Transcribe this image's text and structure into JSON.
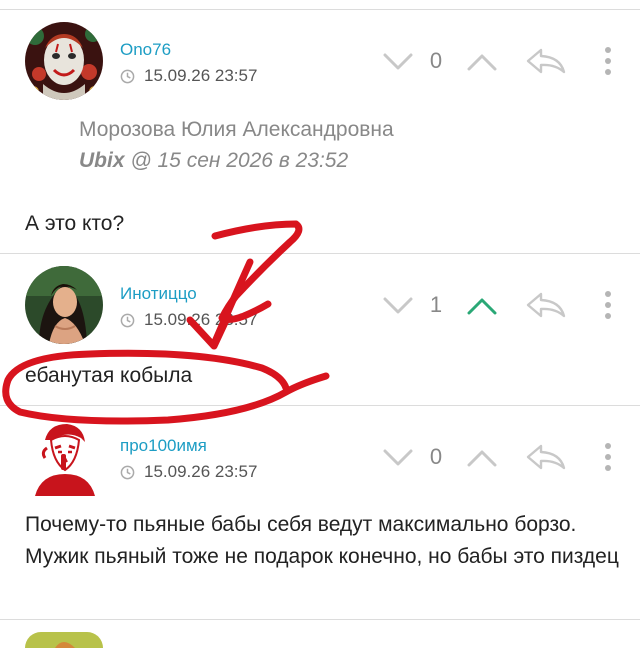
{
  "comments": [
    {
      "author": "Ono76",
      "date": "15.09.26 23:57",
      "score": "0",
      "vote_up_active": false,
      "quote": {
        "author": "Морозова Юлия Александровна",
        "source_user": "Ubix",
        "source_time": " @ 15 сен 2026 в 23:52"
      },
      "text": "А это кто?",
      "avatar": "clown-avatar"
    },
    {
      "author": "Инотиццо",
      "date": "15.09.26 23:57",
      "score": "1",
      "vote_up_active": true,
      "text": "ебанутая кобыла",
      "avatar": "woman-portrait-avatar"
    },
    {
      "author": "про100имя",
      "date": "15.09.26 23:57",
      "score": "0",
      "vote_up_active": false,
      "text": "Почему-то пьяные бабы себя ведут максимально борзо. Мужик пьяный тоже не подарок конечно, но бабы это пиздец",
      "avatar": "red-silhouette-avatar"
    }
  ],
  "colors": {
    "author": "#1d9dc4",
    "icon_gray": "#c8c8c8",
    "vote_up_active": "#2aa876",
    "annotation_red": "#d8141e"
  },
  "icons": [
    "clock-icon",
    "vote-down-icon",
    "vote-up-icon",
    "reply-icon",
    "more-icon"
  ]
}
